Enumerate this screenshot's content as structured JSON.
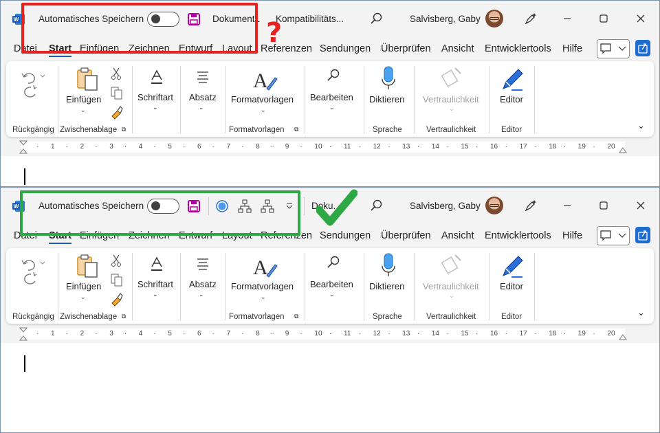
{
  "top": {
    "autosave_label": "Automatisches Speichern",
    "doc_name": "Dokument1",
    "compat_label": "Kompatibilitäts...",
    "user_name": "Salvisberg, Gaby",
    "annotation": "?",
    "annotation_color": "#e42320"
  },
  "bottom": {
    "autosave_label": "Automatisches Speichern",
    "doc_name": "Doku...",
    "user_name": "Salvisberg, Gaby",
    "annotation_color": "#2ea844"
  },
  "tabs": [
    "Datei",
    "Start",
    "Einfügen",
    "Zeichnen",
    "Entwurf",
    "Layout",
    "Referenzen",
    "Sendungen",
    "Überprüfen",
    "Ansicht",
    "Entwicklertools",
    "Hilfe"
  ],
  "active_tab": "Start",
  "ribbon": {
    "buttons": {
      "paste": "Einfügen",
      "font": "Schriftart",
      "paragraph": "Absatz",
      "styles": "Formatvorlagen",
      "editing": "Bearbeiten",
      "dictate": "Diktieren",
      "sensitivity": "Vertraulichkeit",
      "editor": "Editor"
    },
    "groups": {
      "undo": "Rückgängig",
      "clipboard": "Zwischenablage",
      "styles": "Formatvorlagen",
      "voice": "Sprache",
      "sensitivity": "Vertraulichkeit",
      "editor": "Editor"
    }
  },
  "ruler": [
    "1",
    "2",
    "3",
    "4",
    "5",
    "6",
    "7",
    "8",
    "9",
    "10",
    "11",
    "12",
    "13",
    "14",
    "15",
    "16",
    "17",
    "18",
    "19",
    "20"
  ],
  "colors": {
    "accent": "#185abd",
    "save_icon": "#b4009e",
    "share": "#1f6cd1"
  }
}
